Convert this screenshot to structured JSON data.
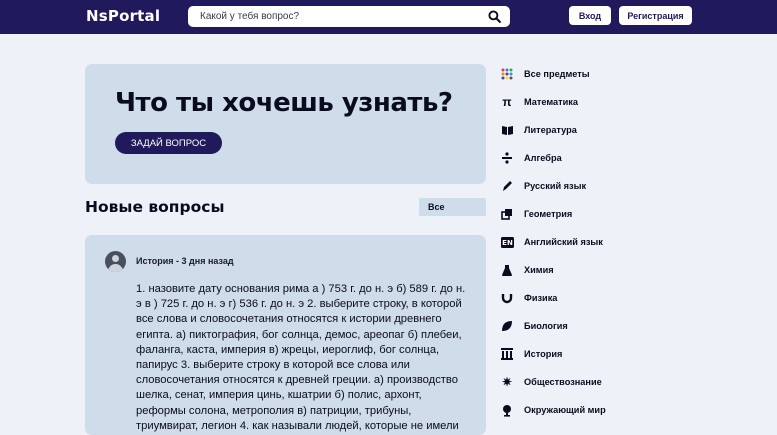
{
  "header": {
    "logo": "NsPortal",
    "search_placeholder": "Какой у тебя вопрос?",
    "login_label": "Вход",
    "register_label": "Регистрация"
  },
  "hero": {
    "title": "Что ты хочешь узнать?",
    "ask_button": "ЗАДАЙ ВОПРОС"
  },
  "questions_section": {
    "title": "Новые вопросы",
    "filter_value": "Все"
  },
  "question": {
    "meta": "История - 3 дня назад",
    "text": "1. назовите дату основания рима а ) 753 г. до н. э б) 589 г. до н. э в ) 725 г. до н. э г) 536 г. до н. э 2. выберите строку, в которой все слова и словосочетания относятся к истории древнего египта. а) пиктография, бог солнца, демос, ареопаг б) плебеи, фаланга, каста, империя в) жрецы, иероглиф, бог солнца, папирус 3. выберите строку в которой все слова или словосочетания относятся к древней греции. а) производство шелка, сенат, империя цинь, кшатрии б) полис, архонт, реформы солона, метрополия в) патриции, трибуны, триумвират, легион 4. как называли людей, которые не имели имущества, свободы"
  },
  "subjects": [
    {
      "label": "Все предметы",
      "icon": "grid-icon"
    },
    {
      "label": "Математика",
      "icon": "pi-icon"
    },
    {
      "label": "Литература",
      "icon": "book-icon"
    },
    {
      "label": "Алгебра",
      "icon": "divide-icon"
    },
    {
      "label": "Русский язык",
      "icon": "pen-icon"
    },
    {
      "label": "Геометрия",
      "icon": "shapes-icon"
    },
    {
      "label": "Английский язык",
      "icon": "en-icon"
    },
    {
      "label": "Химия",
      "icon": "flask-icon"
    },
    {
      "label": "Физика",
      "icon": "magnet-icon"
    },
    {
      "label": "Биология",
      "icon": "leaf-icon"
    },
    {
      "label": "История",
      "icon": "columns-icon"
    },
    {
      "label": "Обществознание",
      "icon": "sun-icon"
    },
    {
      "label": "Окружающий мир",
      "icon": "globe-icon"
    }
  ],
  "colors": {
    "topbar": "#201a5c",
    "card": "#cfdcea",
    "page_bg": "#eef1f8"
  }
}
